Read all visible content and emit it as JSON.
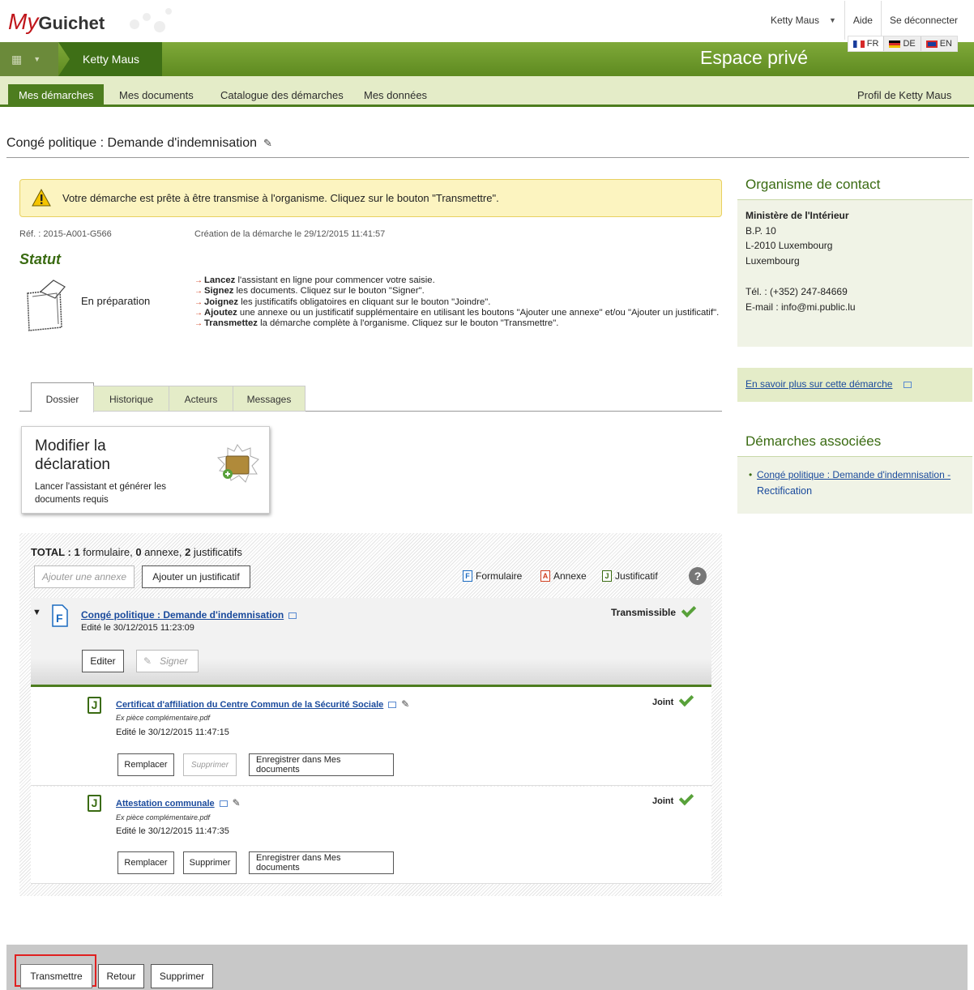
{
  "header": {
    "logo_my": "My",
    "logo_guichet": "Guichet",
    "user_name": "Ketty Maus",
    "help": "Aide",
    "logout": "Se déconnecter",
    "breadcrumb_user": "Ketty Maus",
    "space_title": "Espace privé",
    "languages": [
      "FR",
      "DE",
      "EN"
    ]
  },
  "nav": {
    "items": [
      "Mes démarches",
      "Mes documents",
      "Catalogue des démarches",
      "Mes données"
    ],
    "profile": "Profil de Ketty Maus"
  },
  "page": {
    "title": "Congé politique : Demande d'indemnisation"
  },
  "alert": {
    "text": "Votre démarche est prête à être transmise à l'organisme. Cliquez sur le bouton \"Transmettre\"."
  },
  "meta": {
    "reference": "Réf. : 2015-A001-G566",
    "creation": "Création de la démarche le 29/12/2015 11:41:57"
  },
  "status": {
    "heading": "Statut",
    "label": "En préparation",
    "steps": [
      {
        "bold": "Lancez",
        "text": " l'assistant en ligne pour commencer votre saisie."
      },
      {
        "bold": "Signez",
        "text": " les documents. Cliquez sur le bouton \"Signer\"."
      },
      {
        "bold": "Joignez",
        "text": " les justificatifs obligatoires en cliquant sur le bouton \"Joindre\"."
      },
      {
        "bold": "Ajoutez",
        "text": " une annexe ou un justificatif supplémentaire en utilisant les boutons \"Ajouter une annexe\" et/ou \"Ajouter un justificatif\"."
      },
      {
        "bold": "Transmettez",
        "text": " la démarche complète à l'organisme. Cliquez sur le bouton \"Transmettre\"."
      }
    ]
  },
  "tabs": [
    "Dossier",
    "Historique",
    "Acteurs",
    "Messages"
  ],
  "modify_card": {
    "title": "Modifier la déclaration",
    "subtitle": "Lancer l'assistant et générer les documents requis"
  },
  "documents": {
    "total_label": "TOTAL : ",
    "total_forms": "1",
    "forms_word": " formulaire, ",
    "total_annexes": "0",
    "annexes_word": " annexe, ",
    "total_justifs": "2",
    "justifs_word": " justificatifs",
    "add_annex": "Ajouter une annexe",
    "add_justif": "Ajouter un justificatif",
    "legend": {
      "form": "Formulaire",
      "annex": "Annexe",
      "justif": "Justificatif"
    },
    "form": {
      "title": "Congé politique : Demande d'indemnisation",
      "edited": "Edité le 30/12/2015 11:23:09",
      "status": "Transmissible",
      "edit_btn": "Editer",
      "sign_btn": "Signer"
    },
    "attachments": [
      {
        "title": "Certificat d'affiliation du Centre Commun de la Sécurité Sociale",
        "file": "Ex pièce complémentaire.pdf",
        "edited": "Edité le 30/12/2015 11:47:15",
        "status": "Joint",
        "replace": "Remplacer",
        "delete": "Supprimer",
        "save": "Enregistrer dans Mes documents"
      },
      {
        "title": "Attestation communale",
        "file": "Ex pièce complémentaire.pdf",
        "edited": "Edité le 30/12/2015 11:47:35",
        "status": "Joint",
        "replace": "Remplacer",
        "delete": "Supprimer",
        "save": "Enregistrer dans Mes documents"
      }
    ]
  },
  "sidebar": {
    "contact_heading": "Organisme de contact",
    "org_name": "Ministère de l'Intérieur",
    "address": [
      "B.P. 10",
      "L-2010 Luxembourg",
      "Luxembourg"
    ],
    "phone": "Tél. : (+352) 247-84669",
    "email": "E-mail : info@mi.public.lu",
    "learn_more": "En savoir plus sur cette démarche",
    "related_heading": "Démarches associées",
    "related_link_1": "Congé politique : Demande d'indemnisation -",
    "related_link_2": "Rectification"
  },
  "footer": {
    "transmit": "Transmettre",
    "back": "Retour",
    "delete": "Supprimer"
  },
  "colors": {
    "brand_green": "#4d7d1f",
    "accent_red": "#c0161b",
    "alert_bg": "#fcf4c0",
    "check_green": "#58a13a"
  }
}
